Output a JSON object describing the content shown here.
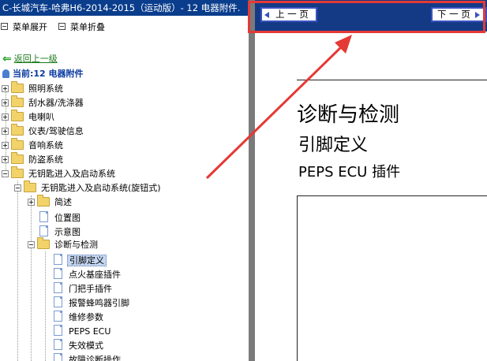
{
  "window": {
    "title": "C-长城汽车-哈弗H6-2014-2015（运动版）- 12 电器附件."
  },
  "menu": {
    "expand_label": "菜单展开",
    "collapse_label": "菜单折叠"
  },
  "back_link": "返回上一级",
  "current": "当前:12 电器附件",
  "tree": [
    {
      "label": "照明系统"
    },
    {
      "label": "刮水器/洗涤器"
    },
    {
      "label": "电喇叭"
    },
    {
      "label": "仪表/驾驶信息"
    },
    {
      "label": "音响系统"
    },
    {
      "label": "防盗系统"
    },
    {
      "label": "无钥匙进入及启动系统"
    },
    {
      "label": "无钥匙进入及启动系统(旋钮式)"
    },
    {
      "label": "简述"
    },
    {
      "label": "位置图"
    },
    {
      "label": "示意图"
    },
    {
      "label": "诊断与检测"
    },
    {
      "label": "引脚定义"
    },
    {
      "label": "点火基座插件"
    },
    {
      "label": "门把手插件"
    },
    {
      "label": "报警蜂鸣器引脚"
    },
    {
      "label": "维修参数"
    },
    {
      "label": "PEPS ECU"
    },
    {
      "label": "失效模式"
    },
    {
      "label": "故障诊断操作"
    }
  ],
  "nav": {
    "prev_label": "上 一 页",
    "next_label": "下 一 页"
  },
  "document": {
    "heading": "诊断与检测",
    "subheading": "引脚定义",
    "section": "PEPS ECU  插件"
  },
  "colors": {
    "titlebar": "#0a3d8c",
    "navbar": "#143a86",
    "highlight": "#e53935",
    "selected": "#c5d7f2"
  }
}
